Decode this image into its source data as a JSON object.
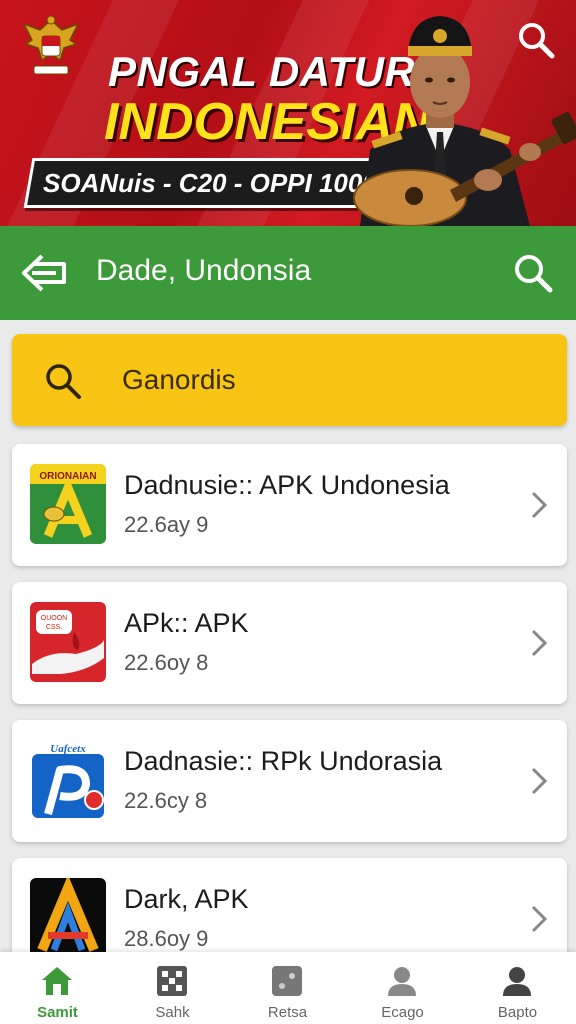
{
  "banner": {
    "title_line1": "PNGAL DATUR",
    "title_line2": "INDONESIAN",
    "subtitle": "SOANuis - C20 - OPPI 10007"
  },
  "header": {
    "title": "Dade, Undonsia"
  },
  "search": {
    "value": "Ganordis"
  },
  "list": [
    {
      "name": "Dadnusie:: APK Undonesia",
      "meta": "22.6ay 9",
      "icon": "green-a-app-icon",
      "icon_text": "ORIONAIAN"
    },
    {
      "name": "APk:: APK",
      "meta": "22.6oy 8",
      "icon": "red-hand-app-icon",
      "icon_text": "OUOON\nCSS."
    },
    {
      "name": "Dadnasie:: RPk Undorasia",
      "meta": "22.6cy 8",
      "icon": "blue-p-app-icon",
      "icon_text": "Uafcetx"
    },
    {
      "name": "Dark, APK",
      "meta": "28.6oy 9",
      "icon": "black-a-app-icon"
    }
  ],
  "nav": [
    {
      "label": "Samit",
      "icon": "home-icon",
      "active": true
    },
    {
      "label": "Sahk",
      "icon": "grid-icon",
      "active": false
    },
    {
      "label": "Retsa",
      "icon": "box-icon",
      "active": false
    },
    {
      "label": "Ecago",
      "icon": "profile-icon",
      "active": false
    },
    {
      "label": "Bapto",
      "icon": "account-icon",
      "active": false
    }
  ],
  "colors": {
    "banner_red": "#c8141c",
    "header_green": "#3c9a3a",
    "search_yellow": "#f8c514",
    "title_yellow": "#ffe21a"
  }
}
